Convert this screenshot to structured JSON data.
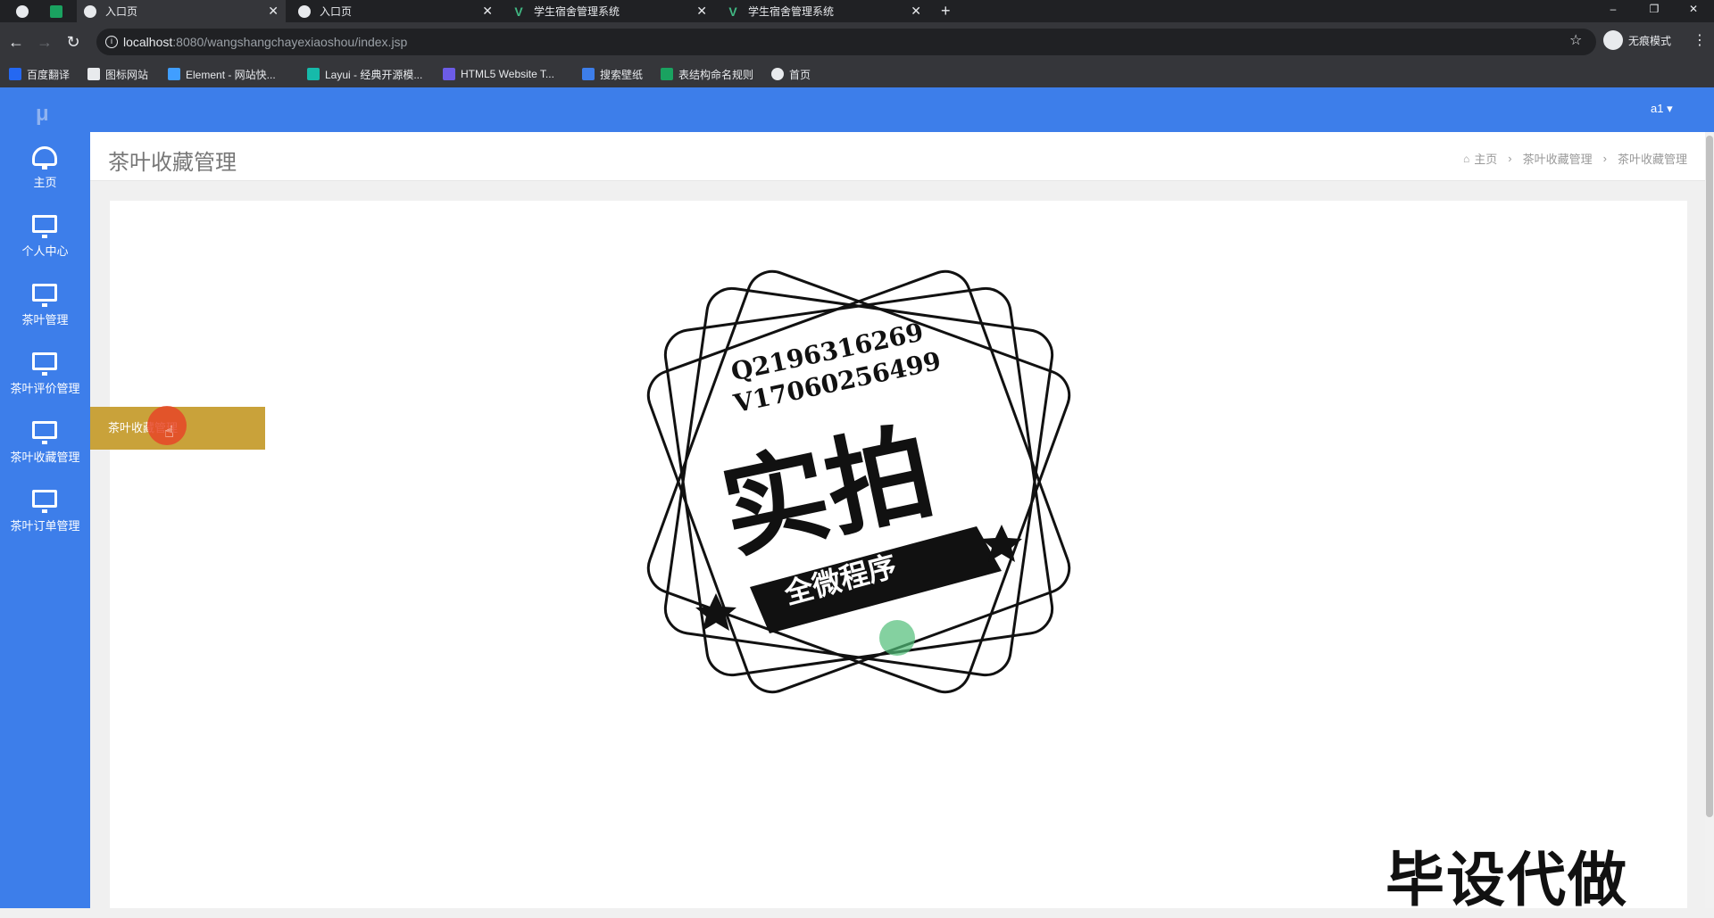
{
  "browser": {
    "tabs": [
      {
        "label": "入口页",
        "icon": "globe-icon",
        "active": true
      },
      {
        "label": "入口页",
        "icon": "globe-icon",
        "active": false
      },
      {
        "label": "学生宿舍管理系统",
        "icon": "vue-icon",
        "active": false
      },
      {
        "label": "学生宿舍管理系统",
        "icon": "vue-icon",
        "active": false
      }
    ],
    "new_tab": "+",
    "window_controls": [
      "–",
      "❐",
      "✕"
    ],
    "url_host": "localhost",
    "url_rest": ":8080/wangshangchayexiaoshou/index.jsp",
    "profile_label": "无痕模式",
    "bookmarks": [
      {
        "label": "百度翻译",
        "color": "#2468f2"
      },
      {
        "label": "图标网站",
        "color": "#ffffff"
      },
      {
        "label": "Element - 网站快...",
        "color": "#409eff"
      },
      {
        "label": "Layui - 经典开源模...",
        "color": "#16baaa"
      },
      {
        "label": "HTML5 Website T...",
        "color": "#6c5ce7"
      },
      {
        "label": "搜索壁纸",
        "color": "#3d7eea"
      },
      {
        "label": "表结构命名规则",
        "color": "#1aa260"
      },
      {
        "label": "首页",
        "color": "#e8eaed"
      }
    ]
  },
  "app": {
    "logo": "μ",
    "user": "a1 ▾",
    "accent_color": "#3d7eea",
    "sidebar": [
      {
        "label": "主页",
        "icon": "dashboard-icon"
      },
      {
        "label": "个人中心",
        "icon": "monitor-icon"
      },
      {
        "label": "茶叶管理",
        "icon": "monitor-icon"
      },
      {
        "label": "茶叶评价管理",
        "icon": "monitor-icon"
      },
      {
        "label": "茶叶收藏管理",
        "icon": "monitor-icon"
      },
      {
        "label": "茶叶订单管理",
        "icon": "monitor-icon"
      }
    ],
    "flyout_item": "茶叶收藏管理",
    "page_title": "茶叶收藏管理",
    "breadcrumb": [
      "主页",
      "茶叶收藏管理",
      "茶叶收藏管理"
    ]
  },
  "overlay": {
    "stamp_line1": "Q2196316269",
    "stamp_line2": "V17060256499",
    "stamp_main": "实拍",
    "stamp_banner": "全微程序",
    "corner_text": "毕设代做"
  }
}
